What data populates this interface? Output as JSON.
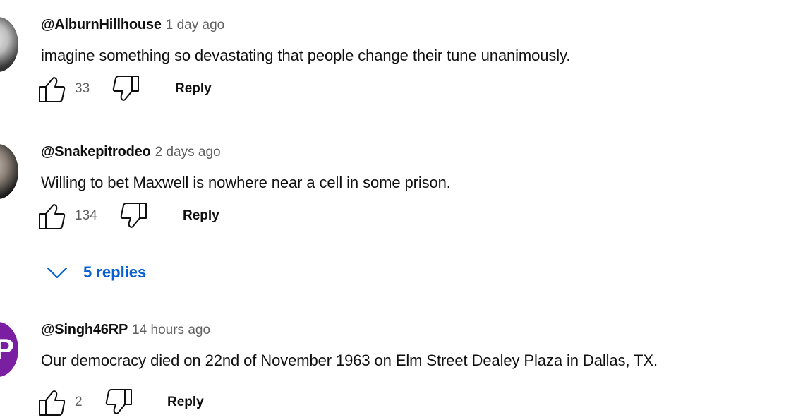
{
  "comments": [
    {
      "author": "@AlburnHillhouse",
      "time": "1 day ago",
      "text": "imagine something so devastating that people change their tune unanimously.",
      "likes": "33",
      "reply_label": "Reply",
      "avatar": "photo-avatar"
    },
    {
      "author": "@Snakepitrodeo",
      "time": "2 days ago",
      "text": "Willing to bet Maxwell is nowhere near a cell in some prison.",
      "likes": "134",
      "reply_label": "Reply",
      "avatar": "photo-avatar",
      "replies_label": "5 replies"
    },
    {
      "author": "@Singh46RP",
      "time": "14 hours ago",
      "text": "Our democracy died on 22nd of November 1963 on Elm Street Dealey Plaza in Dallas, TX.",
      "likes": "2",
      "reply_label": "Reply",
      "avatar": "letter-avatar",
      "avatar_letter": "P",
      "avatar_color": "#7b1fa2"
    }
  ],
  "colors": {
    "link_blue": "#065fd4",
    "meta_gray": "#606060",
    "text": "#0f0f0f"
  }
}
